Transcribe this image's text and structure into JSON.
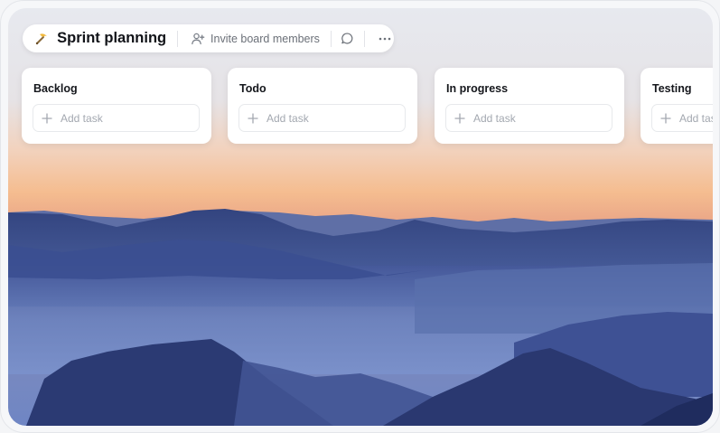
{
  "board": {
    "icon": "pickaxe-icon",
    "title": "Sprint planning",
    "invite_label": "Invite board members",
    "comment_icon": "comment-icon",
    "more_icon": "more-horizontal-icon"
  },
  "columns": [
    {
      "title": "Backlog",
      "add_label": "Add task"
    },
    {
      "title": "Todo",
      "add_label": "Add task"
    },
    {
      "title": "In progress",
      "add_label": "Add task"
    },
    {
      "title": "Testing",
      "add_label": "Add task"
    }
  ],
  "colors": {
    "sky_top": "#dfe2ec",
    "horizon": "#f3b889",
    "mountain_dark": "#2c3f7c",
    "mist": "#6f86c0"
  }
}
